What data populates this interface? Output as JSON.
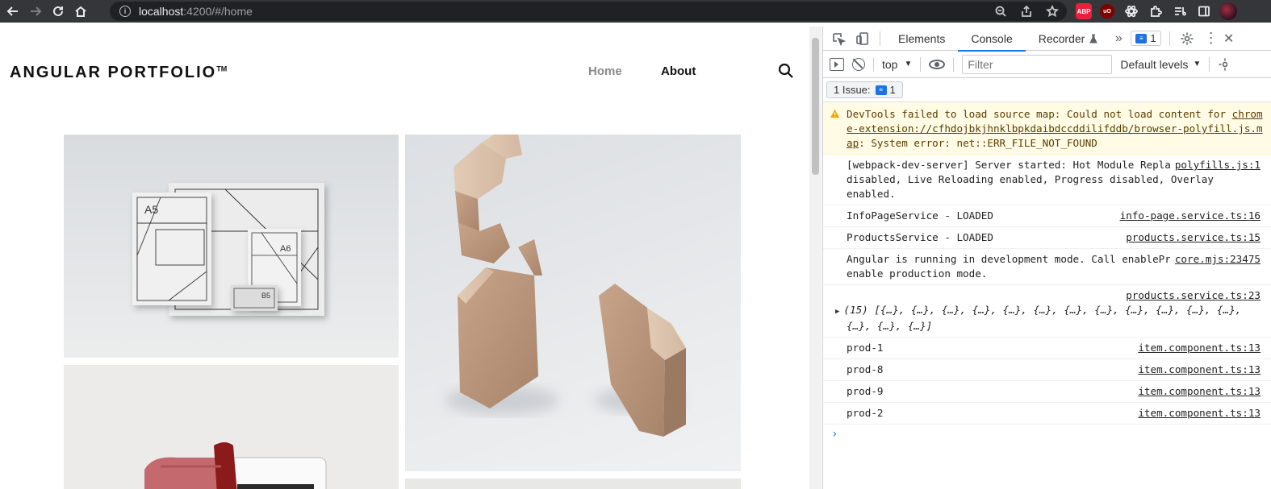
{
  "browser": {
    "url_host": "localhost",
    "url_rest": ":4200/#/home",
    "extensions": {
      "abp": "ABP",
      "ublock": "uO"
    }
  },
  "site": {
    "brand": "ANGULAR PORTFOLIO",
    "brand_mark": "TM",
    "nav": {
      "home": "Home",
      "about": "About"
    },
    "tiles": [
      {
        "name": "stationery-mockup",
        "labels": [
          "A5",
          "A6",
          "B5"
        ]
      },
      {
        "name": "wooden-blocks"
      },
      {
        "name": "red-tablet-case"
      },
      {
        "name": "next-item"
      }
    ]
  },
  "devtools": {
    "tabs": [
      "Elements",
      "Console",
      "Recorder"
    ],
    "active_tab": "Console",
    "recorder_icon": "flask-icon",
    "issues_badge": "1",
    "context": "top",
    "filter_placeholder": "Filter",
    "levels": "Default levels",
    "issues_label": "1 Issue:",
    "issues_count": "1",
    "messages": [
      {
        "type": "warning",
        "text1": "DevTools failed to load source map: Could not load content for ",
        "link": "chrome-extension://cfhdojbkjhnklbpkdaibdccddilifddb/browser-polyfill.js.map",
        "text2": ": System error: net::ERR_FILE_NOT_FOUND"
      },
      {
        "type": "log",
        "text": "[webpack-dev-server] Server started: Hot Module Replacement disabled, Live Reloading enabled, Progress disabled, Overlay enabled.",
        "source": "polyfills.js:1"
      },
      {
        "type": "log",
        "text": "InfoPageService - LOADED",
        "source": "info-page.service.ts:16"
      },
      {
        "type": "log",
        "text": "ProductsService - LOADED",
        "source": "products.service.ts:15"
      },
      {
        "type": "log",
        "text": "Angular is running in development mode. Call enableProdMode() to enable production mode.",
        "source": "core.mjs:23475"
      },
      {
        "type": "object",
        "text": "(15) [{…}, {…}, {…}, {…}, {…}, {…}, {…}, {…}, {…}, {…}, {…}, {…}, {…}, {…}, {…}]",
        "source": "products.service.ts:23"
      },
      {
        "type": "log",
        "text": "prod-1",
        "source": "item.component.ts:13"
      },
      {
        "type": "log",
        "text": "prod-8",
        "source": "item.component.ts:13"
      },
      {
        "type": "log",
        "text": "prod-9",
        "source": "item.component.ts:13"
      },
      {
        "type": "log",
        "text": "prod-2",
        "source": "item.component.ts:13"
      }
    ],
    "prompt": "›"
  }
}
